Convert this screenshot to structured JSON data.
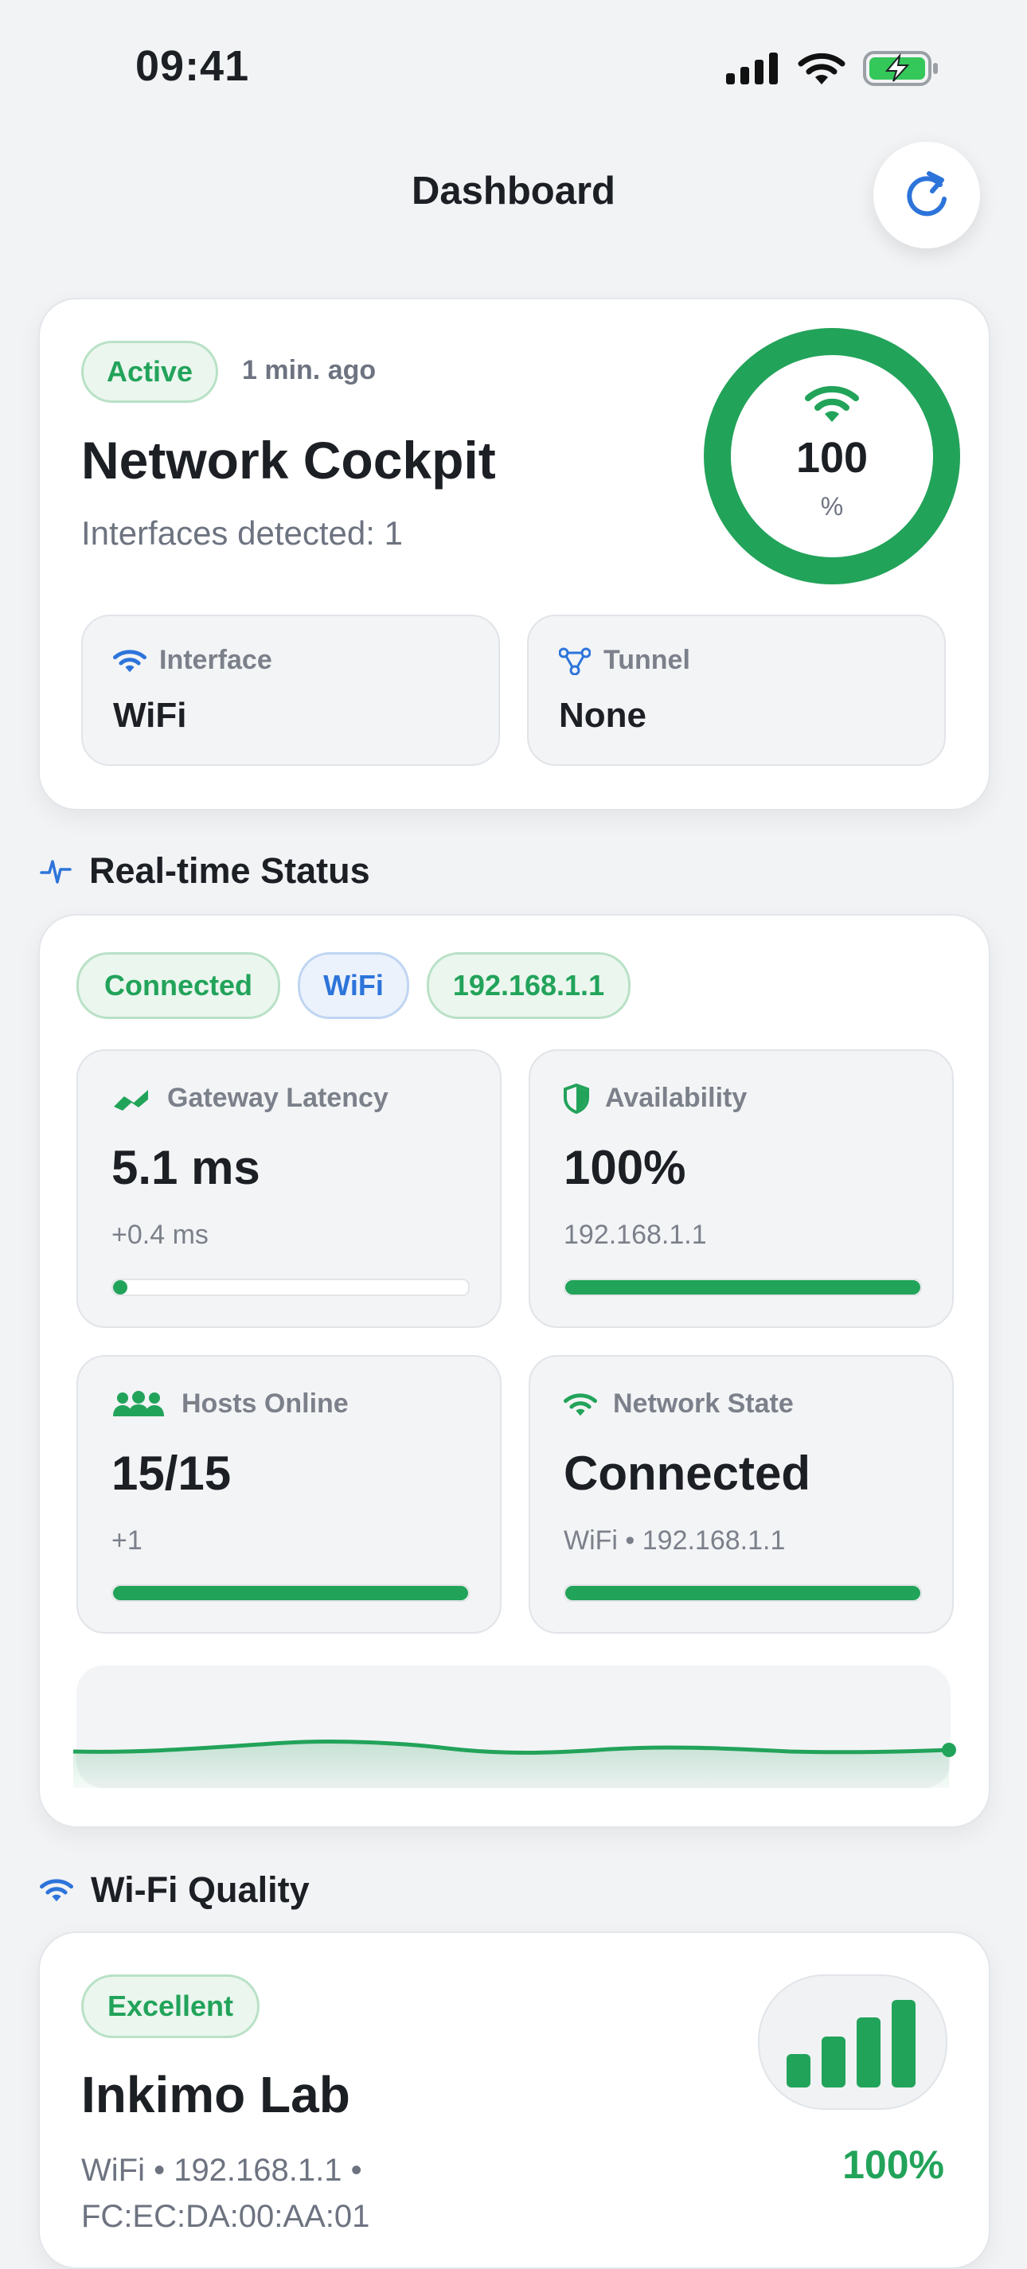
{
  "status_bar": {
    "time": "09:41"
  },
  "header": {
    "title": "Dashboard"
  },
  "overview": {
    "badge": "Active",
    "updated": "1 min. ago",
    "title": "Network Cockpit",
    "subtitle": "Interfaces detected: 1",
    "gauge_value": "100",
    "gauge_unit": "%",
    "gauge_level": 1.0,
    "interface_label": "Interface",
    "interface_value": "WiFi",
    "tunnel_label": "Tunnel",
    "tunnel_value": "None"
  },
  "realtime": {
    "section_title": "Real-time Status",
    "chips": [
      "Connected",
      "WiFi",
      "192.168.1.1"
    ],
    "metrics": {
      "latency": {
        "label": "Gateway Latency",
        "value": "5.1 ms",
        "sub": "+0.4 ms",
        "level": 0.02
      },
      "availability": {
        "label": "Availability",
        "value": "100%",
        "sub": "192.168.1.1",
        "level": 1.0
      },
      "hosts": {
        "label": "Hosts Online",
        "value": "15/15",
        "sub": "+1",
        "level": 1.0
      },
      "state": {
        "label": "Network State",
        "value": "Connected",
        "sub": "WiFi • 192.168.1.1",
        "level": 1.0
      }
    }
  },
  "wifi": {
    "section_title": "Wi-Fi Quality",
    "badge": "Excellent",
    "name": "Inkimo Lab",
    "detail_line1": "WiFi • 192.168.1.1 •",
    "detail_line2": "FC:EC:DA:00:AA:01",
    "signal_percent": "100%",
    "signal_bars": 4
  },
  "colors": {
    "accent_green": "#22a35a",
    "accent_blue": "#2d74da",
    "background": "#f2f3f5"
  }
}
